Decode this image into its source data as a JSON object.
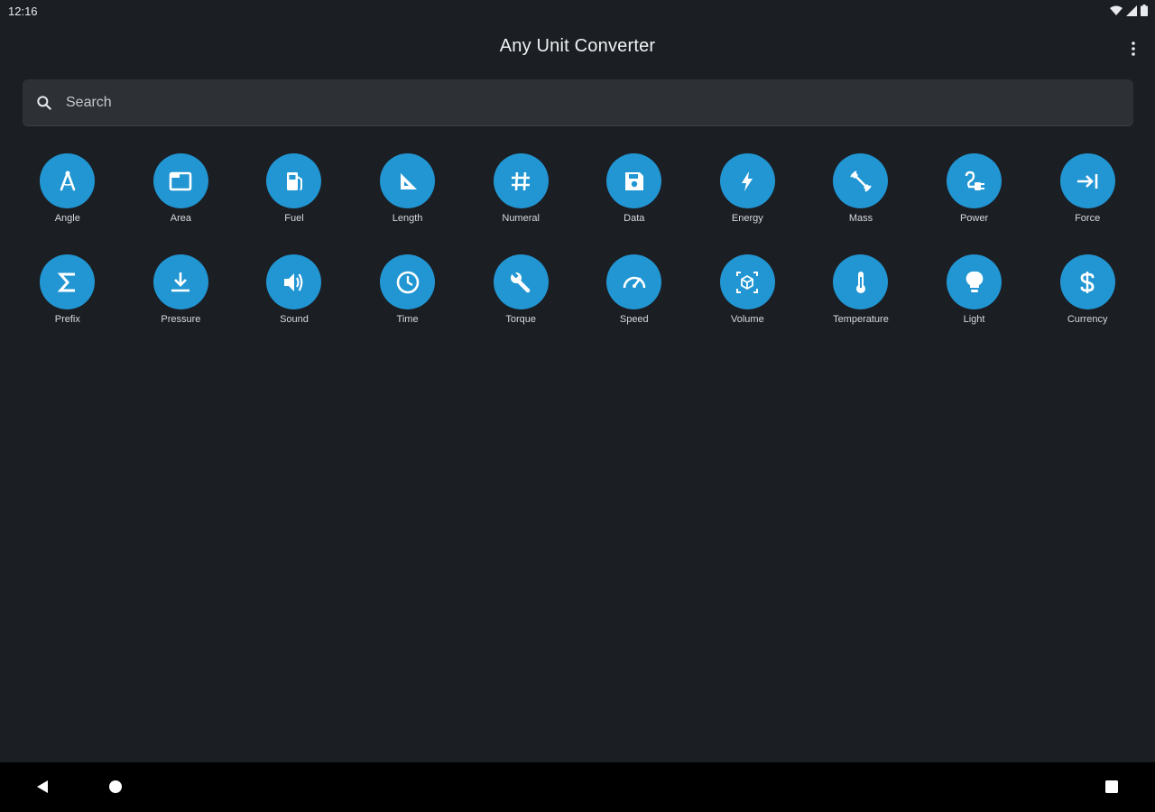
{
  "status": {
    "time": "12:16"
  },
  "header": {
    "title": "Any Unit Converter"
  },
  "search": {
    "placeholder": "Search",
    "value": ""
  },
  "categories": [
    {
      "label": "Angle",
      "icon": "angle-icon"
    },
    {
      "label": "Area",
      "icon": "area-icon"
    },
    {
      "label": "Fuel",
      "icon": "fuel-icon"
    },
    {
      "label": "Length",
      "icon": "length-icon"
    },
    {
      "label": "Numeral",
      "icon": "numeral-icon"
    },
    {
      "label": "Data",
      "icon": "data-icon"
    },
    {
      "label": "Energy",
      "icon": "energy-icon"
    },
    {
      "label": "Mass",
      "icon": "mass-icon"
    },
    {
      "label": "Power",
      "icon": "power-icon"
    },
    {
      "label": "Force",
      "icon": "force-icon"
    },
    {
      "label": "Prefix",
      "icon": "prefix-icon"
    },
    {
      "label": "Pressure",
      "icon": "pressure-icon"
    },
    {
      "label": "Sound",
      "icon": "sound-icon"
    },
    {
      "label": "Time",
      "icon": "time-icon"
    },
    {
      "label": "Torque",
      "icon": "torque-icon"
    },
    {
      "label": "Speed",
      "icon": "speed-icon"
    },
    {
      "label": "Volume",
      "icon": "volume-icon"
    },
    {
      "label": "Temperature",
      "icon": "temperature-icon"
    },
    {
      "label": "Light",
      "icon": "light-icon"
    },
    {
      "label": "Currency",
      "icon": "currency-icon"
    }
  ],
  "colors": {
    "accent": "#2196d3",
    "background": "#1b1e23",
    "search_bg": "#2d3136"
  }
}
